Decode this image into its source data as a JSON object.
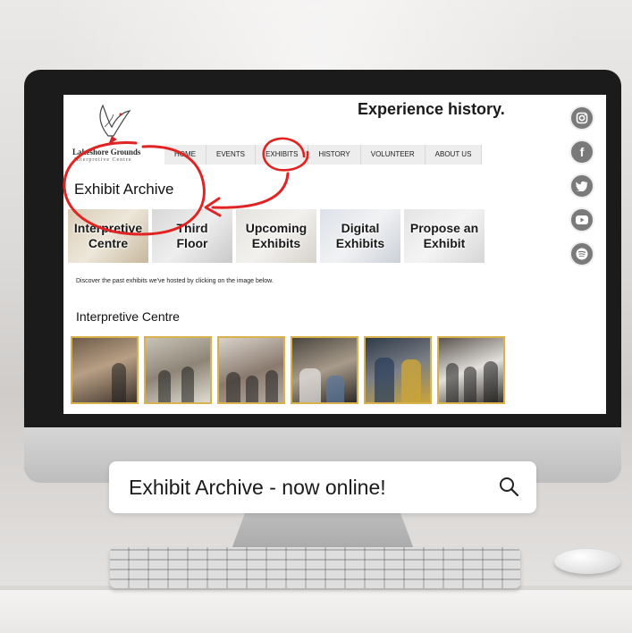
{
  "site": {
    "tagline": "Experience history.",
    "logo_name": "Lakeshore Grounds",
    "logo_sub": "Interpretive Centre"
  },
  "nav": [
    "HOME",
    "EVENTS",
    "EXHIBITS",
    "HISTORY",
    "VOLUNTEER",
    "ABOUT US"
  ],
  "page": {
    "title": "Exhibit Archive",
    "tiles": [
      {
        "line1": "Interpretive",
        "line2": "Centre"
      },
      {
        "line1": "Third",
        "line2": "Floor"
      },
      {
        "line1": "Upcoming",
        "line2": "Exhibits"
      },
      {
        "line1": "Digital",
        "line2": "Exhibits"
      },
      {
        "line1": "Propose an",
        "line2": "Exhibit"
      }
    ],
    "discover_text": "Discover the past exhibits we've hosted by clicking on the image below.",
    "section_title": "Interpretive Centre"
  },
  "social_icons": [
    "instagram-icon",
    "facebook-icon",
    "twitter-icon",
    "youtube-icon",
    "spotify-icon"
  ],
  "search": {
    "text": "Exhibit Archive - now online!"
  },
  "colors": {
    "annotation_red": "#e02424",
    "photo_border": "#d8b24c",
    "social_grey": "#7a7a7a"
  }
}
